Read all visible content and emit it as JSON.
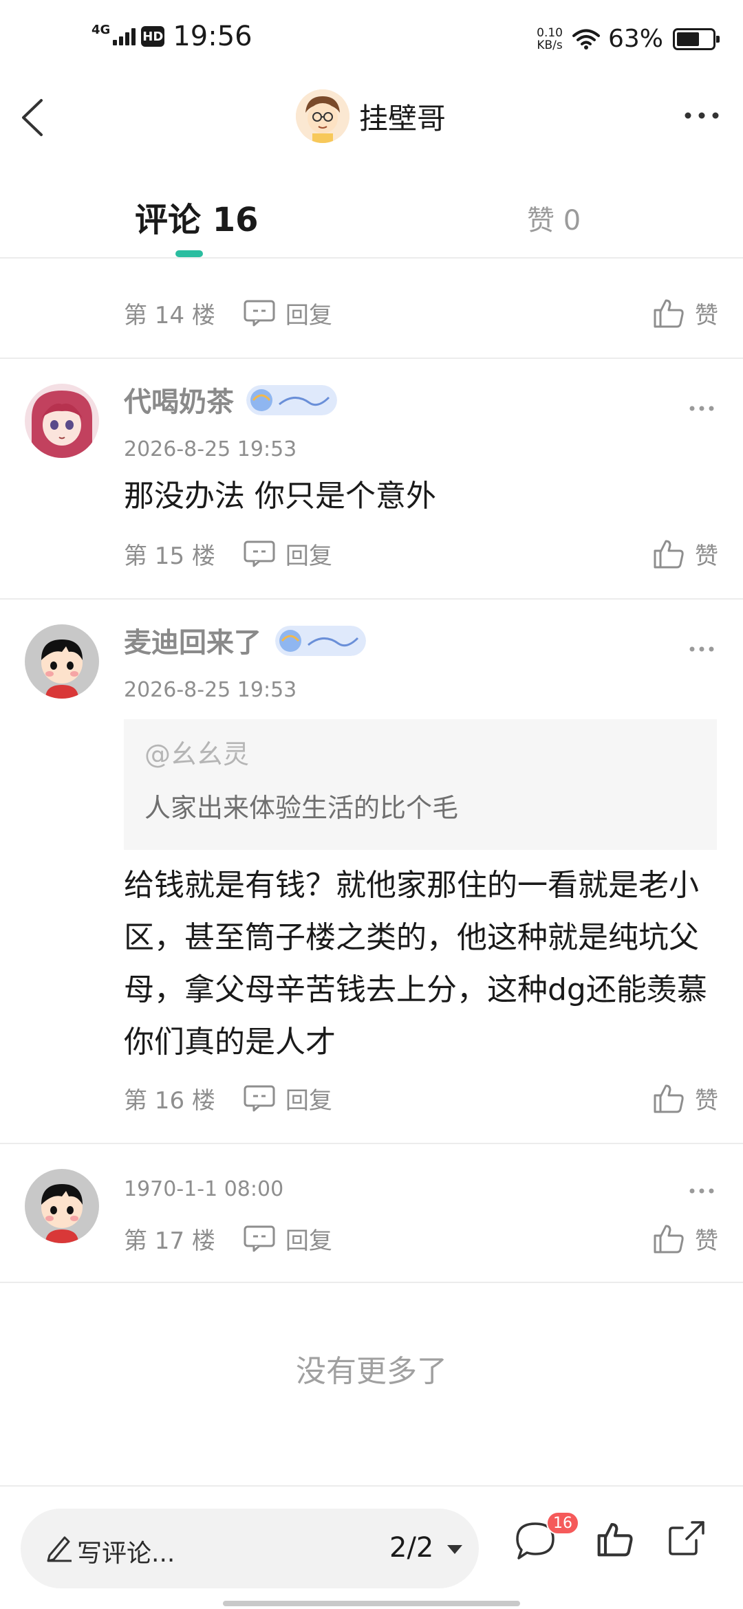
{
  "status_bar": {
    "network": "4G",
    "hd": "HD",
    "time": "19:56",
    "speed_value": "0.10",
    "speed_unit": "KB/s",
    "battery_pct": "63%",
    "battery_level": 0.63
  },
  "header": {
    "title": "挂壁哥"
  },
  "tabs": {
    "comments": "评论 16",
    "likes": "赞 0"
  },
  "comments": [
    {
      "floor": "第 14 楼",
      "reply": "回复",
      "like": "赞"
    },
    {
      "user": "代喝奶茶",
      "date": "2026-8-25 19:53",
      "text": "那没办法 你只是个意外",
      "floor": "第 15 楼",
      "reply": "回复",
      "like": "赞"
    },
    {
      "user": "麦迪回来了",
      "date": "2026-8-25 19:53",
      "quote_user": "@幺幺灵",
      "quote_text": "人家出来体验生活的比个毛",
      "text": "给钱就是有钱？就他家那住的一看就是老小区，甚至筒子楼之类的，他这种就是纯坑父母，拿父母辛苦钱去上分，这种dg还能羡慕你们真的是人才",
      "floor": "第 16 楼",
      "reply": "回复",
      "like": "赞"
    },
    {
      "date": "1970-1-1 08:00",
      "floor": "第 17 楼",
      "reply": "回复",
      "like": "赞"
    }
  ],
  "footer": {
    "no_more": "没有更多了"
  },
  "bottom_bar": {
    "write_placeholder": "写评论...",
    "page": "2/2",
    "comment_count": "16"
  },
  "colors": {
    "accent": "#2bbda0",
    "badge_red": "#f55a5a",
    "muted_text": "#8e8e8e"
  }
}
